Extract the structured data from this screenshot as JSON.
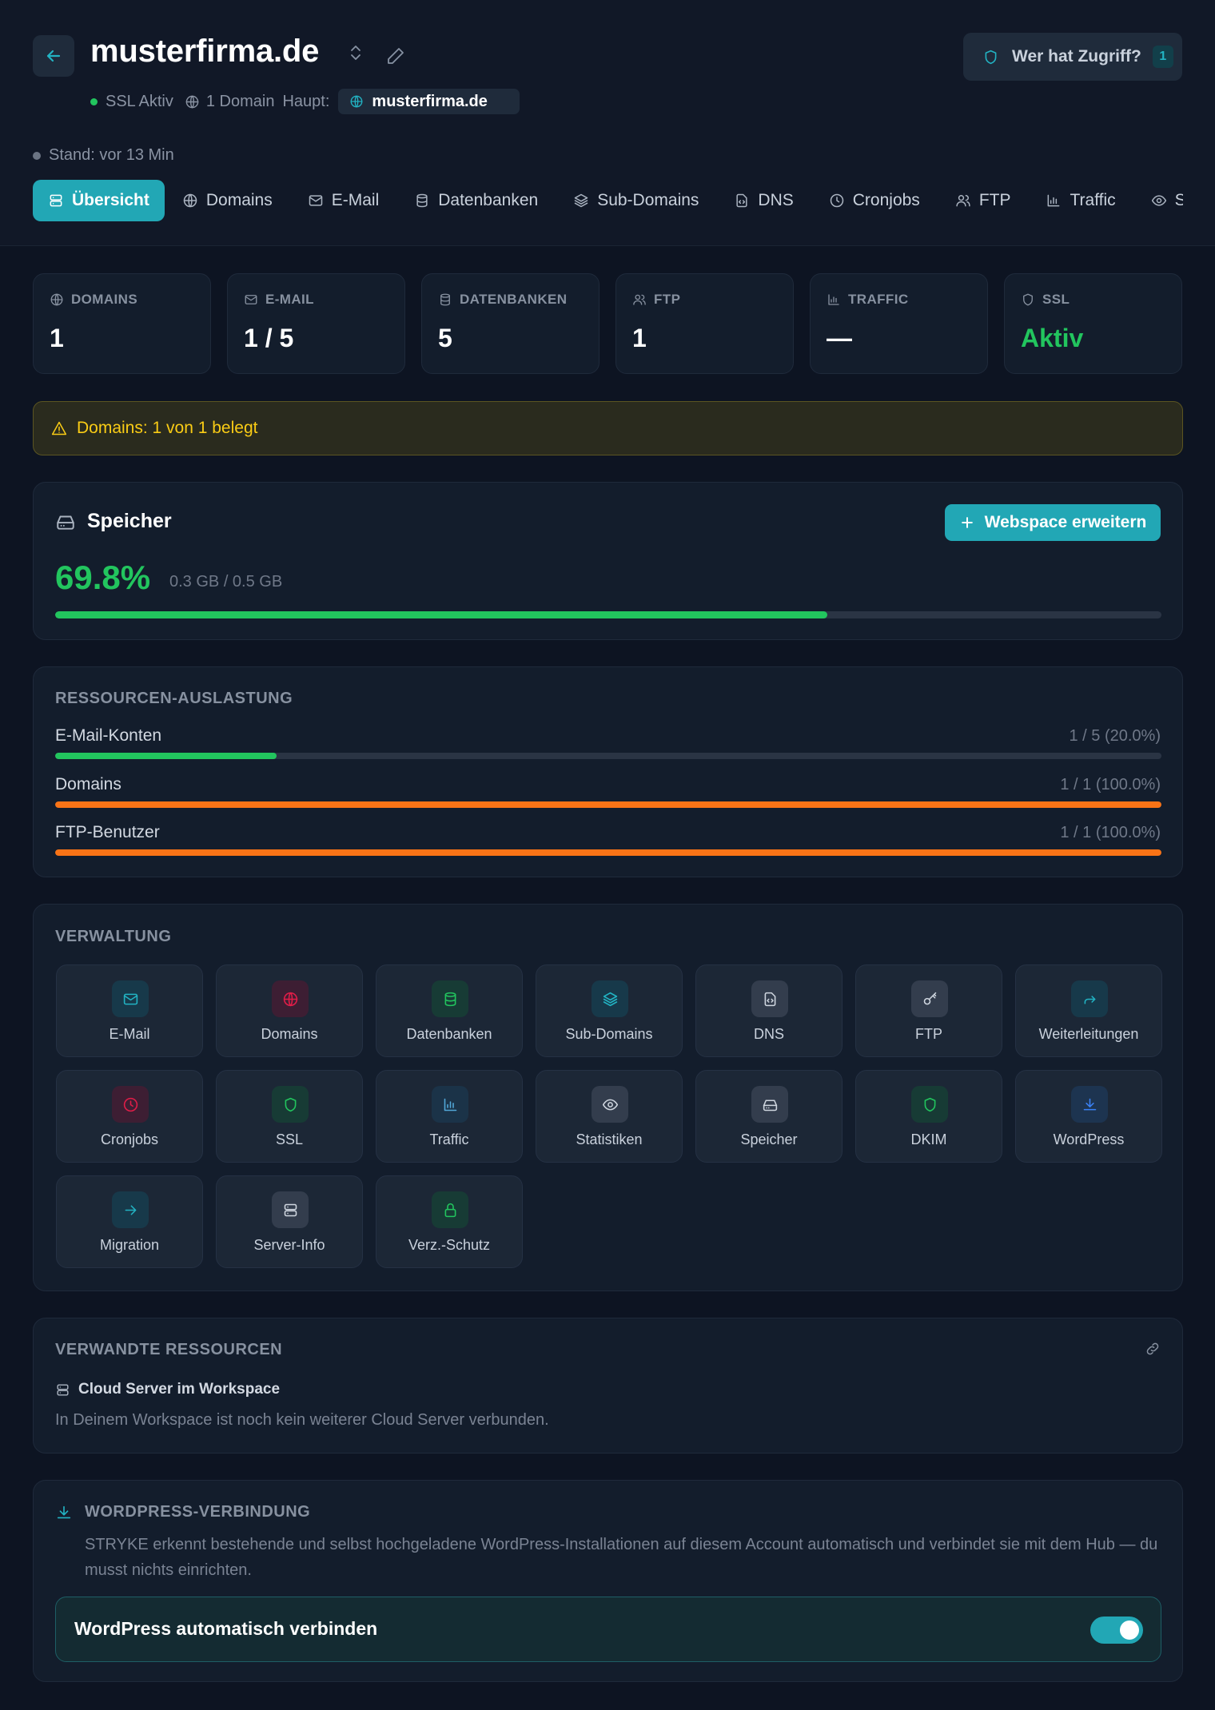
{
  "header": {
    "title": "musterfirma.de",
    "ssl_status": "SSL Aktiv",
    "domain_count": "1 Domain",
    "main_label": "Haupt:",
    "main_domain": "musterfirma.de",
    "access_label": "Wer hat Zugriff?",
    "access_count": "1",
    "stand": "Stand: vor 13 Min"
  },
  "tabs": [
    {
      "label": "Übersicht",
      "icon": "server-icon",
      "active": true
    },
    {
      "label": "Domains",
      "icon": "globe-icon"
    },
    {
      "label": "E-Mail",
      "icon": "mail-icon"
    },
    {
      "label": "Datenbanken",
      "icon": "database-icon"
    },
    {
      "label": "Sub-Domains",
      "icon": "layers-icon"
    },
    {
      "label": "DNS",
      "icon": "file-code-icon"
    },
    {
      "label": "Cronjobs",
      "icon": "clock-icon"
    },
    {
      "label": "FTP",
      "icon": "users-icon"
    },
    {
      "label": "Traffic",
      "icon": "bar-chart-icon"
    },
    {
      "label": "Statistiken",
      "icon": "eye-icon"
    }
  ],
  "stats": [
    {
      "label": "DOMAINS",
      "value": "1",
      "icon": "globe-icon"
    },
    {
      "label": "E-MAIL",
      "value": "1 / 5",
      "icon": "mail-icon"
    },
    {
      "label": "DATENBANKEN",
      "value": "5",
      "icon": "database-icon"
    },
    {
      "label": "FTP",
      "value": "1",
      "icon": "users-icon"
    },
    {
      "label": "TRAFFIC",
      "value": "—",
      "icon": "bar-chart-icon"
    },
    {
      "label": "SSL",
      "value": "Aktiv",
      "icon": "shield-icon",
      "color": "#22c55e"
    }
  ],
  "warning": "Domains: 1 von 1 belegt",
  "storage": {
    "title": "Speicher",
    "percent": "69.8%",
    "fill_fraction": 0.698,
    "size": "0.3 GB / 0.5 GB",
    "expand_label": "Webspace erweitern"
  },
  "resources": {
    "title": "RESSOURCEN-AUSLASTUNG",
    "rows": [
      {
        "label": "E-Mail-Konten",
        "value": "1 / 5 (20.0%)",
        "fill_fraction": 0.2,
        "color": "#22c55e"
      },
      {
        "label": "Domains",
        "value": "1 / 1 (100.0%)",
        "fill_fraction": 1.0,
        "color": "#f97316"
      },
      {
        "label": "FTP-Benutzer",
        "value": "1 / 1 (100.0%)",
        "fill_fraction": 1.0,
        "color": "#f97316"
      }
    ]
  },
  "management": {
    "title": "VERWALTUNG",
    "tiles": [
      {
        "label": "E-Mail",
        "icon": "mail-icon"
      },
      {
        "label": "Domains",
        "icon": "globe-icon"
      },
      {
        "label": "Datenbanken",
        "icon": "database-icon"
      },
      {
        "label": "Sub-Domains",
        "icon": "layers-icon"
      },
      {
        "label": "DNS",
        "icon": "file-code-icon"
      },
      {
        "label": "FTP",
        "icon": "key-icon"
      },
      {
        "label": "Weiterleitungen",
        "icon": "forward-icon"
      },
      {
        "label": "Cronjobs",
        "icon": "clock-icon"
      },
      {
        "label": "SSL",
        "icon": "shield-icon"
      },
      {
        "label": "Traffic",
        "icon": "bar-chart-icon"
      },
      {
        "label": "Statistiken",
        "icon": "eye-icon"
      },
      {
        "label": "Speicher",
        "icon": "hard-drive-icon"
      },
      {
        "label": "DKIM",
        "icon": "shield-icon"
      },
      {
        "label": "WordPress",
        "icon": "download-icon"
      },
      {
        "label": "Migration",
        "icon": "arrow-right-icon"
      },
      {
        "label": "Server-Info",
        "icon": "server-icon"
      },
      {
        "label": "Verz.-Schutz",
        "icon": "lock-icon"
      }
    ]
  },
  "related": {
    "title": "VERWANDTE RESSOURCEN",
    "subtitle": "Cloud Server im Workspace",
    "text": "In Deinem Workspace ist noch kein weiterer Cloud Server verbunden."
  },
  "wordpress": {
    "title": "WORDPRESS-VERBINDUNG",
    "description": "STRYKE erkennt bestehende und selbst hochgeladene WordPress-Installationen auf diesem Account automatisch und verbindet sie mit dem Hub — du musst nichts einrichten.",
    "toggle_label": "WordPress automatisch verbinden",
    "toggle_on": true
  },
  "colors": {
    "accent": "#22a7b5",
    "success": "#22c55e",
    "warning": "#facc15",
    "danger": "#f97316"
  }
}
